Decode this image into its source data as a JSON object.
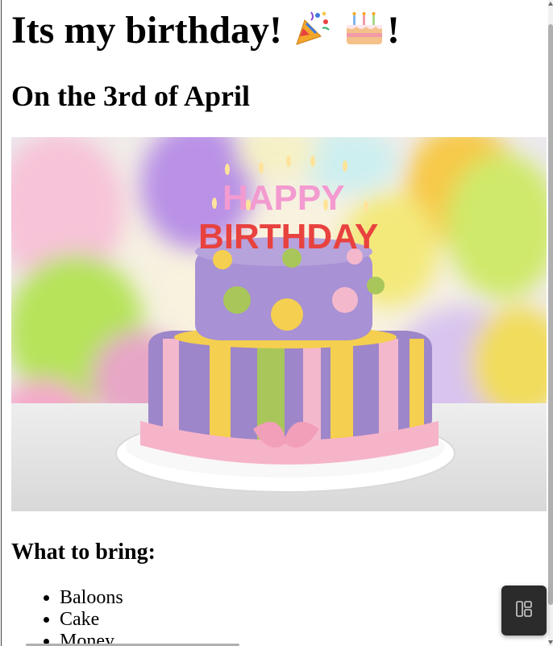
{
  "page": {
    "heading": "Its my birthday!",
    "heading_suffix": "!",
    "subheading": "On the 3rd of April",
    "bring_heading": "What to bring:",
    "bring_items": [
      "Baloons",
      "Cake",
      "Money"
    ]
  },
  "image": {
    "cake_top_text_1": "HAPPY",
    "cake_top_text_2": "BIRTHDAY"
  },
  "icons": {
    "party_popper": "party-popper-icon",
    "cake": "birthday-cake-icon",
    "fab": "layout-grid-icon"
  },
  "colors": {
    "cake_purple": "#9d86c9",
    "cake_pink": "#f4b8cc",
    "cake_yellow": "#f5cf4f",
    "cake_green": "#a9c65a",
    "fab_bg": "#2b2b2b"
  }
}
